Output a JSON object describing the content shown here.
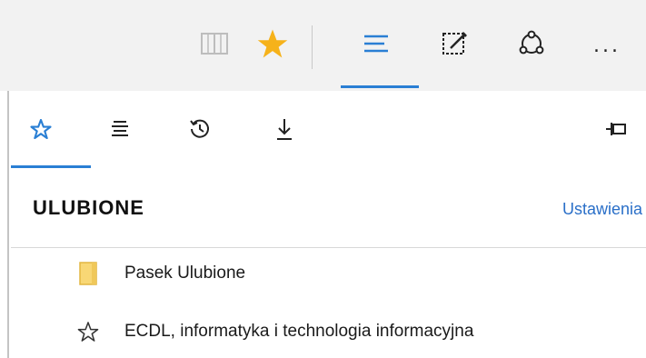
{
  "toolbar": {
    "buttons": [
      {
        "name": "reading-view-icon"
      },
      {
        "name": "favorite-star-icon"
      },
      {
        "name": "hub-icon"
      },
      {
        "name": "web-note-icon"
      },
      {
        "name": "share-icon"
      },
      {
        "name": "more-icon",
        "label": "..."
      }
    ],
    "colors": {
      "accent": "#2a7fd4",
      "star": "#f6b21a"
    }
  },
  "hub": {
    "tabs": [
      {
        "name": "favorites-tab-icon",
        "active": true
      },
      {
        "name": "reading-list-tab-icon"
      },
      {
        "name": "history-tab-icon"
      },
      {
        "name": "downloads-tab-icon"
      }
    ],
    "pin_icon": "pin-icon",
    "title": "ULUBIONE",
    "settings_label": "Ustawienia",
    "items": [
      {
        "icon": "folder-icon",
        "label": "Pasek Ulubione"
      },
      {
        "icon": "star-outline-icon",
        "label": "ECDL, informatyka i technologia informacyjna"
      }
    ]
  }
}
